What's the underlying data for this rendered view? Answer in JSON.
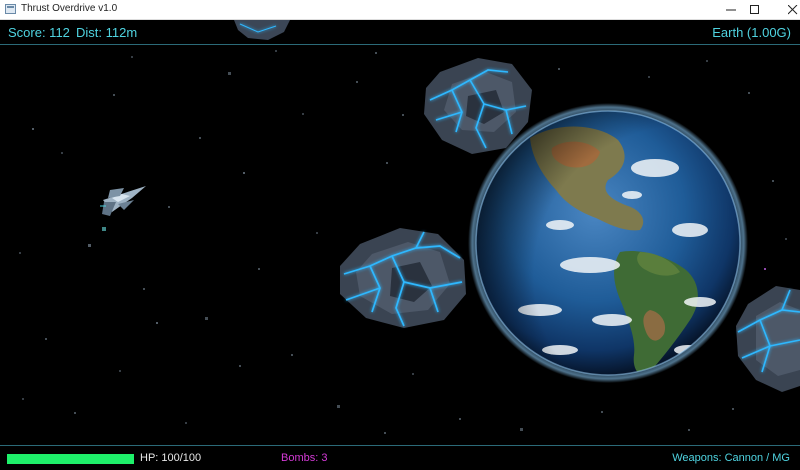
{
  "window": {
    "title": "Thrust Overdrive v1.0",
    "controls": [
      "minimize-icon",
      "maximize-icon",
      "close-icon"
    ]
  },
  "hud": {
    "score": "Score: 112",
    "distance": "Dist: 112m",
    "planet": "Earth (1.00G)",
    "hp_text": "HP: 100/100",
    "hp_fraction": 1.0,
    "bombs": "Bombs: 3",
    "weapons": "Weapons: Cannon / MG"
  },
  "colors": {
    "hud_cyan": "#4fd3e0",
    "hp_green": "#1ef06a",
    "bombs_magenta": "#d43ad6",
    "asteroid_glow": "#2fb8ff"
  },
  "scene": {
    "planet": "earth",
    "player": "spaceship",
    "asteroid_count": 4
  }
}
